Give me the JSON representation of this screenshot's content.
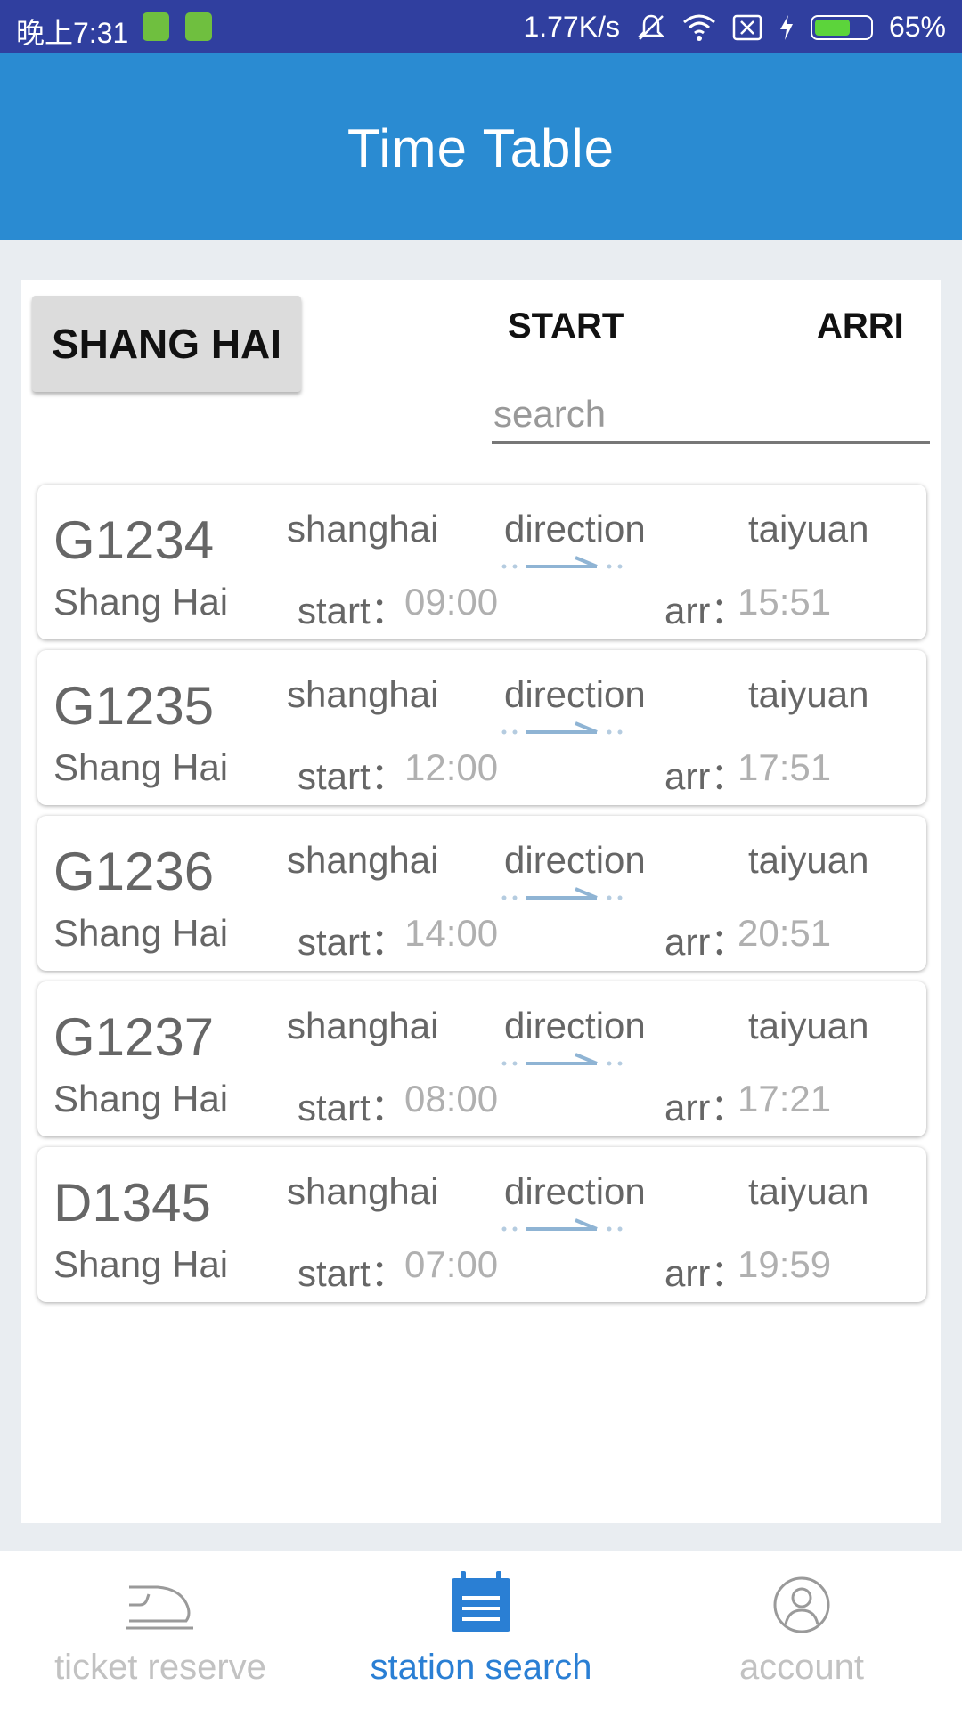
{
  "status_bar": {
    "time": "晚上7:31",
    "net_speed": "1.77K/s",
    "battery_pct": "65%",
    "battery_level": 0.65,
    "icons": [
      "sim-icon",
      "android-icon",
      "mute-icon",
      "wifi-icon",
      "no-sim-icon",
      "charging-icon",
      "battery-icon"
    ]
  },
  "app_bar": {
    "title": "Time Table"
  },
  "header": {
    "city_button": "SHANG HAI",
    "start_label": "START",
    "arri_label": "ARRI"
  },
  "search": {
    "placeholder": "search",
    "value": ""
  },
  "trains": [
    {
      "number": "G1234",
      "city": "Shang Hai",
      "from": "shanghai",
      "direction": "direction",
      "to": "taiyuan",
      "start_label": "start：",
      "start": "09:00",
      "arr_label": "arr：",
      "arr": "15:51"
    },
    {
      "number": "G1235",
      "city": "Shang Hai",
      "from": "shanghai",
      "direction": "direction",
      "to": "taiyuan",
      "start_label": "start：",
      "start": "12:00",
      "arr_label": "arr：",
      "arr": "17:51"
    },
    {
      "number": "G1236",
      "city": "Shang Hai",
      "from": "shanghai",
      "direction": "direction",
      "to": "taiyuan",
      "start_label": "start：",
      "start": "14:00",
      "arr_label": "arr：",
      "arr": "20:51"
    },
    {
      "number": "G1237",
      "city": "Shang Hai",
      "from": "shanghai",
      "direction": "direction",
      "to": "taiyuan",
      "start_label": "start：",
      "start": "08:00",
      "arr_label": "arr：",
      "arr": "17:21"
    },
    {
      "number": "D1345",
      "city": "Shang Hai",
      "from": "shanghai",
      "direction": "direction",
      "to": "taiyuan",
      "start_label": "start：",
      "start": "07:00",
      "arr_label": "arr：",
      "arr": "19:59"
    }
  ],
  "bottom_nav": {
    "items": [
      {
        "label": "ticket reserve",
        "icon": "train-icon",
        "active": false
      },
      {
        "label": "station search",
        "icon": "calendar-icon",
        "active": true
      },
      {
        "label": "account",
        "icon": "person-icon",
        "active": false
      }
    ]
  },
  "colors": {
    "status_bar": "#303f9f",
    "app_bar": "#2a8bd2",
    "nav_active": "#2a7fd4",
    "nav_inactive": "#c2c2c2",
    "arrow": "#8fb4d4"
  }
}
